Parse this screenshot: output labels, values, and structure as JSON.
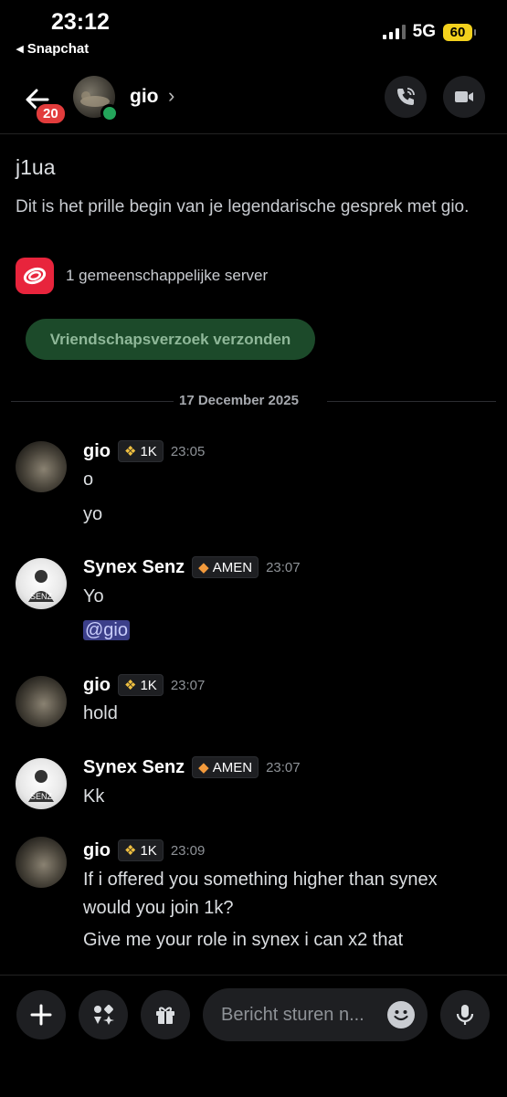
{
  "status": {
    "time": "23:12",
    "back_app": "◂ Snapchat",
    "network": "5G",
    "battery": "60"
  },
  "header": {
    "unread_badge": "20",
    "name": "gio",
    "chevron": "›"
  },
  "intro": {
    "display_name": "gio",
    "handle": "j1ua",
    "description": "Dit is het prille begin van je legendarische gesprek met gio.",
    "mutual_servers": "1 gemeenschappelijke server",
    "friend_request_label": "Vriendschapsverzoek verzonden"
  },
  "date_divider": "17 December 2025",
  "messages": [
    {
      "author": "gio",
      "tag": "1K",
      "time": "23:05",
      "lines": [
        "o",
        "yo"
      ]
    },
    {
      "author": "Synex Senz",
      "tag": "AMEN",
      "time": "23:07",
      "lines": [
        "Yo",
        "@gio"
      ]
    },
    {
      "author": "gio",
      "tag": "1K",
      "time": "23:07",
      "lines": [
        "hold"
      ]
    },
    {
      "author": "Synex Senz",
      "tag": "AMEN",
      "time": "23:07",
      "lines": [
        "Kk"
      ]
    },
    {
      "author": "gio",
      "tag": "1K",
      "time": "23:09",
      "lines": [
        "If i offered you something higher than synex",
        "would you join 1k?",
        "Give me your role in synex i can x2 that"
      ]
    }
  ],
  "composer": {
    "placeholder": "Bericht sturen n..."
  },
  "colors": {
    "online": "#23a55a",
    "badge": "#e23c3c",
    "friend_button": "#1c4a2a",
    "mention": "#3c3f8a",
    "server_icon": "#e8243c"
  },
  "icons": [
    "back-arrow-icon",
    "phone-icon",
    "video-icon",
    "plus-icon",
    "apps-icon",
    "gift-icon",
    "emoji-icon",
    "mic-icon"
  ]
}
